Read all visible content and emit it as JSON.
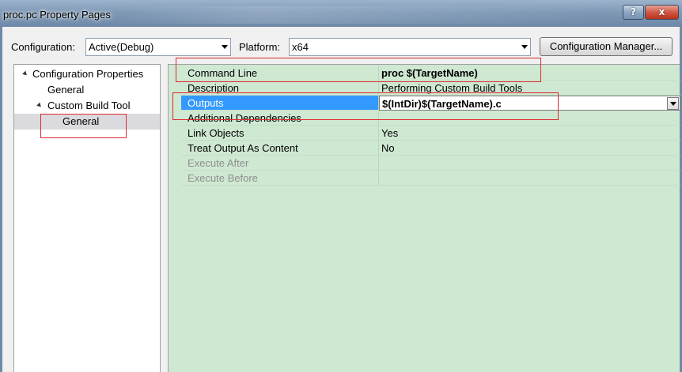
{
  "window": {
    "title": "proc.pc Property Pages",
    "help_label": "?",
    "close_label": "x"
  },
  "config": {
    "configuration_label": "Configuration:",
    "configuration_value": "Active(Debug)",
    "platform_label": "Platform:",
    "platform_value": "x64",
    "manager_button": "Configuration Manager..."
  },
  "tree": {
    "items": [
      {
        "label": "Configuration Properties",
        "expanded": true
      },
      {
        "label": "General"
      },
      {
        "label": "Custom Build Tool",
        "expanded": true
      },
      {
        "label": "General",
        "selected": true
      }
    ]
  },
  "properties": {
    "rows": [
      {
        "name": "Command Line",
        "value": "proc $(TargetName)",
        "bold": true
      },
      {
        "name": "Description",
        "value": "Performing Custom Build Tools"
      },
      {
        "name": "Outputs",
        "value": "$(IntDir)$(TargetName).c",
        "selected": true
      },
      {
        "name": "Additional Dependencies",
        "value": ""
      },
      {
        "name": "Link Objects",
        "value": "Yes"
      },
      {
        "name": "Treat Output As Content",
        "value": "No"
      },
      {
        "name": "Execute After",
        "value": "",
        "disabled": true
      },
      {
        "name": "Execute Before",
        "value": "",
        "disabled": true
      }
    ]
  },
  "colors": {
    "grid_background": "#cfe8d2",
    "selection": "#3399ff",
    "annotation": "#e0282e"
  }
}
